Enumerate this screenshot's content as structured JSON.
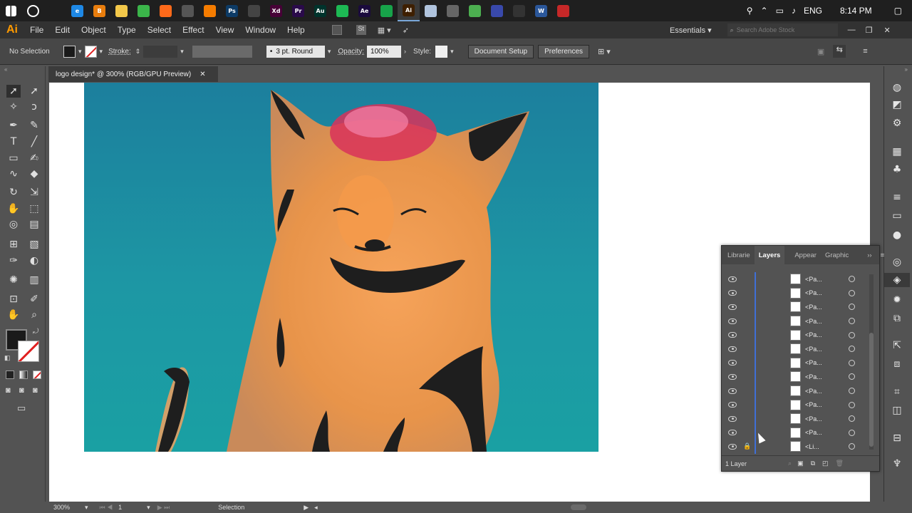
{
  "window": {
    "app": "Ai"
  },
  "menu": {
    "items": [
      "File",
      "Edit",
      "Object",
      "Type",
      "Select",
      "Effect",
      "View",
      "Window",
      "Help"
    ],
    "workspace": "Essentials",
    "search_placeholder": "Search Adobe Stock"
  },
  "control": {
    "selection": "No Selection",
    "stroke_label": "Stroke:",
    "brush": "3 pt. Round",
    "opacity_label": "Opacity:",
    "opacity_value": "100%",
    "style_label": "Style:",
    "document_setup": "Document Setup",
    "preferences": "Preferences"
  },
  "document": {
    "tab_title": "logo design* @ 300% (RGB/GPU Preview)"
  },
  "tray": {
    "lang": "ENG",
    "time": "8:14 PM"
  },
  "taskbar": {
    "apps": [
      {
        "name": "task-view",
        "label": "",
        "color": "#1f1f1f"
      },
      {
        "name": "edge",
        "label": "e",
        "color": "#1e88e5"
      },
      {
        "name": "blender",
        "label": "B",
        "color": "#e87d0d"
      },
      {
        "name": "explorer",
        "label": "",
        "color": "#f3c84a"
      },
      {
        "name": "chrome",
        "label": "",
        "color": "#3bb54a"
      },
      {
        "name": "firefox",
        "label": "",
        "color": "#ff6a1a"
      },
      {
        "name": "app",
        "label": "",
        "color": "#555555"
      },
      {
        "name": "app2",
        "label": "",
        "color": "#f57c00"
      },
      {
        "name": "photoshop",
        "label": "Ps",
        "color": "#0d3b66"
      },
      {
        "name": "obs",
        "label": "",
        "color": "#444444"
      },
      {
        "name": "xd",
        "label": "Xd",
        "color": "#470137"
      },
      {
        "name": "premiere",
        "label": "Pr",
        "color": "#2a0a4a"
      },
      {
        "name": "audition",
        "label": "Au",
        "color": "#00332c"
      },
      {
        "name": "spotify",
        "label": "",
        "color": "#1db954"
      },
      {
        "name": "aftereffects",
        "label": "Ae",
        "color": "#1a0a3d"
      },
      {
        "name": "app3",
        "label": "",
        "color": "#17a34a"
      },
      {
        "name": "illustrator",
        "label": "Ai",
        "color": "#3e1f00"
      },
      {
        "name": "app4",
        "label": "",
        "color": "#b0c4de"
      },
      {
        "name": "app5",
        "label": "",
        "color": "#666666"
      },
      {
        "name": "app6",
        "label": "",
        "color": "#4caf50"
      },
      {
        "name": "app7",
        "label": "",
        "color": "#3949ab"
      },
      {
        "name": "settings",
        "label": "",
        "color": "#333333"
      },
      {
        "name": "word",
        "label": "W",
        "color": "#2b579a"
      },
      {
        "name": "app8",
        "label": "",
        "color": "#c62828"
      }
    ]
  },
  "layers_panel": {
    "tabs": [
      "Librarie",
      "Layers",
      "Appear",
      "Graphic"
    ],
    "active_tab": "Layers",
    "rows": [
      "<Pa...",
      "<Pa...",
      "<Pa...",
      "<Pa...",
      "<Pa...",
      "<Pa...",
      "<Pa...",
      "<Pa...",
      "<Pa...",
      "<Pa...",
      "<Pa...",
      "<Pa...",
      "<Li..."
    ],
    "footer": "1 Layer"
  },
  "status": {
    "zoom": "300%",
    "artboard": "1",
    "tool": "Selection"
  },
  "colors": {
    "accent": "#3f6fd6",
    "ai_orange": "#ff9a00",
    "canvas_bg": "#535353"
  }
}
